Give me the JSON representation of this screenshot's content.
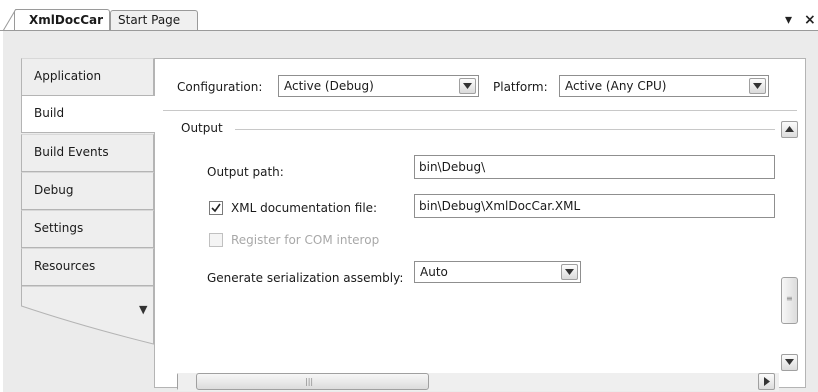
{
  "tabs": {
    "active": "XmlDocCar",
    "inactive": "Start Page"
  },
  "window_controls": {
    "dropdown_glyph": "▾",
    "close_glyph": "×"
  },
  "sidebar": {
    "items": [
      {
        "label": "Application"
      },
      {
        "label": "Build"
      },
      {
        "label": "Build Events"
      },
      {
        "label": "Debug"
      },
      {
        "label": "Settings"
      },
      {
        "label": "Resources"
      }
    ],
    "active_index": 1,
    "more_glyph": "▼"
  },
  "toolbar": {
    "configuration_label": "Configuration:",
    "configuration_value": "Active (Debug)",
    "platform_label": "Platform:",
    "platform_value": "Active (Any CPU)"
  },
  "output": {
    "group_title": "Output",
    "output_path_label": "Output path:",
    "output_path_value": "bin\\Debug\\",
    "xml_doc_label": "XML documentation file:",
    "xml_doc_checked": true,
    "xml_doc_value": "bin\\Debug\\XmlDocCar.XML",
    "com_interop_label": "Register for COM interop",
    "com_interop_checked": false,
    "serialization_label": "Generate serialization assembly:",
    "serialization_value": "Auto"
  },
  "icons": {
    "tab_dropdown": "chevron-down-icon",
    "tab_close": "close-icon",
    "scroll_up": "scroll-up-arrow-icon",
    "scroll_down": "scroll-down-arrow-icon",
    "scroll_left": "scroll-left-arrow-icon",
    "scroll_right": "scroll-right-arrow-icon"
  }
}
